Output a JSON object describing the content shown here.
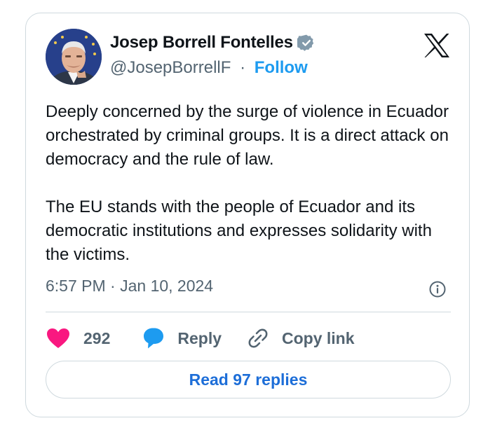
{
  "author": {
    "name": "Josep Borrell Fontelles",
    "handle": "@JosepBorrellF",
    "separator": "·",
    "follow_label": "Follow"
  },
  "tweet": {
    "paragraphs": [
      "Deeply concerned by the surge of violence in Ecuador orchestrated by criminal groups. It is a direct attack on democracy and the rule of law.",
      "The EU stands with the people of Ecuador and its democratic institutions and expresses solidarity with the victims."
    ],
    "timestamp": "6:57 PM · Jan 10, 2024"
  },
  "actions": {
    "like_count": "292",
    "reply_label": "Reply",
    "copy_label": "Copy link"
  },
  "read_replies_label": "Read 97 replies",
  "icons": [
    "verified-badge-icon",
    "x-logo-icon",
    "info-icon",
    "heart-icon",
    "reply-bubble-icon",
    "link-icon"
  ],
  "colors": {
    "accent": "#1d9bf0",
    "like": "#f91880",
    "secondary_text": "#536471",
    "border": "#cfd9de"
  }
}
